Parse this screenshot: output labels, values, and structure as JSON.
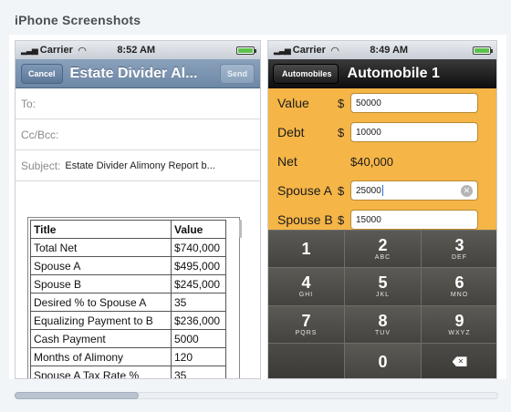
{
  "section_title": "iPhone Screenshots",
  "phone1": {
    "status": {
      "carrier": "Carrier",
      "time": "8:52 AM",
      "battery_level": 1.0
    },
    "navbar": {
      "cancel": "Cancel",
      "title": "Estate Divider Al...",
      "send": "Send"
    },
    "fields": {
      "to": "To:",
      "ccbcc": "Cc/Bcc:",
      "subject_label": "Subject:",
      "subject_value": "Estate Divider Alimony Report b..."
    },
    "table": {
      "headers": [
        "Title",
        "Value"
      ],
      "rows": [
        [
          "Total Net",
          "$740,000"
        ],
        [
          "Spouse A",
          "$495,000"
        ],
        [
          "Spouse B",
          "$245,000"
        ],
        [
          "Desired % to Spouse A",
          "35"
        ],
        [
          "Equalizing Payment to B",
          "$236,000"
        ],
        [
          "Cash Payment",
          "5000"
        ],
        [
          "Months of Alimony",
          "120"
        ],
        [
          "Spouse A Tax Rate %",
          "35"
        ]
      ]
    }
  },
  "phone2": {
    "status": {
      "carrier": "Carrier",
      "time": "8:49 AM",
      "battery_level": 1.0
    },
    "navbar": {
      "back": "Automobiles",
      "title": "Automobile 1"
    },
    "form": {
      "value_label": "Value",
      "value": "50000",
      "debt_label": "Debt",
      "debt": "10000",
      "net_label": "Net",
      "net": "$40,000",
      "spouse_a_label": "Spouse A",
      "spouse_a": "25000",
      "spouse_b_label": "Spouse B",
      "spouse_b": "15000",
      "currency": "$"
    },
    "keypad": {
      "keys": [
        {
          "num": "1",
          "letters": ""
        },
        {
          "num": "2",
          "letters": "ABC"
        },
        {
          "num": "3",
          "letters": "DEF"
        },
        {
          "num": "4",
          "letters": "GHI"
        },
        {
          "num": "5",
          "letters": "JKL"
        },
        {
          "num": "6",
          "letters": "MNO"
        },
        {
          "num": "7",
          "letters": "PQRS"
        },
        {
          "num": "8",
          "letters": "TUV"
        },
        {
          "num": "9",
          "letters": "WXYZ"
        },
        {
          "num": "",
          "letters": ""
        },
        {
          "num": "0",
          "letters": ""
        },
        {
          "num": "",
          "letters": ""
        }
      ]
    }
  },
  "colors": {
    "orange_bg": "#f5b547",
    "blue_nav": "#7b93b0",
    "black_nav": "#111111",
    "keypad": "#4a4a47"
  }
}
